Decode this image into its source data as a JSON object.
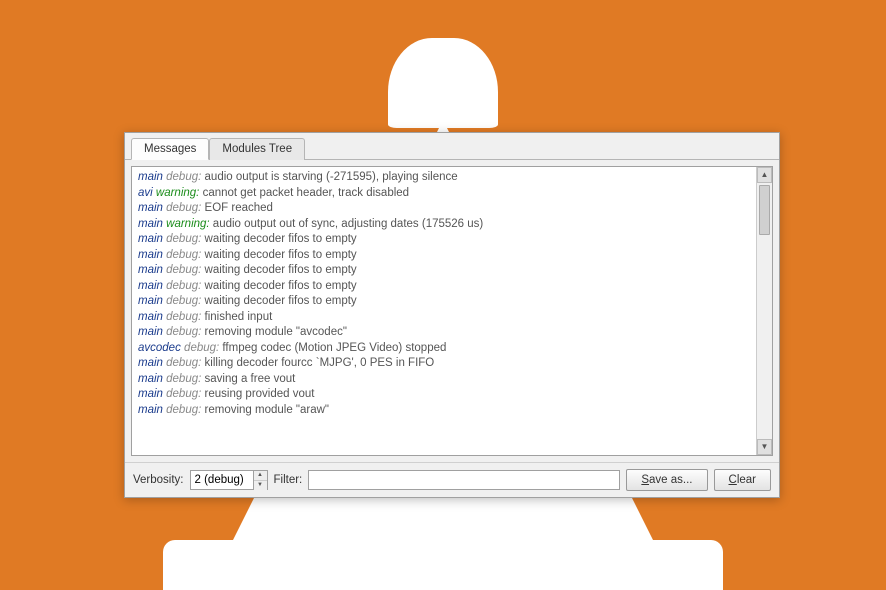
{
  "tabs": {
    "messages": "Messages",
    "modules": "Modules Tree"
  },
  "log_lines": [
    {
      "module": "main",
      "level": "debug",
      "text": " audio output is starving (-271595), playing silence"
    },
    {
      "module": "avi",
      "level": "warning",
      "text": " cannot get packet header, track disabled"
    },
    {
      "module": "main",
      "level": "debug",
      "text": " EOF reached"
    },
    {
      "module": "main",
      "level": "warning",
      "text": " audio output out of sync, adjusting dates (175526 us)"
    },
    {
      "module": "main",
      "level": "debug",
      "text": " waiting decoder fifos to empty"
    },
    {
      "module": "main",
      "level": "debug",
      "text": " waiting decoder fifos to empty"
    },
    {
      "module": "main",
      "level": "debug",
      "text": " waiting decoder fifos to empty"
    },
    {
      "module": "main",
      "level": "debug",
      "text": " waiting decoder fifos to empty"
    },
    {
      "module": "main",
      "level": "debug",
      "text": " waiting decoder fifos to empty"
    },
    {
      "module": "main",
      "level": "debug",
      "text": " finished input"
    },
    {
      "module": "main",
      "level": "debug",
      "text": " removing module \"avcodec\""
    },
    {
      "module": "avcodec",
      "level": "debug",
      "text": " ffmpeg codec (Motion JPEG Video) stopped"
    },
    {
      "module": "main",
      "level": "debug",
      "text": " killing decoder fourcc `MJPG', 0 PES in FIFO"
    },
    {
      "module": "main",
      "level": "debug",
      "text": " saving a free vout"
    },
    {
      "module": "main",
      "level": "debug",
      "text": " reusing provided vout"
    },
    {
      "module": "main",
      "level": "debug",
      "text": " removing module \"araw\""
    }
  ],
  "bottom": {
    "verbosity_label": "Verbosity:",
    "verbosity_value": "2 (debug)",
    "filter_label": "Filter:",
    "filter_value": "",
    "save_prefix": "S",
    "save_rest": "ave as...",
    "clear_prefix": "C",
    "clear_rest": "lear"
  }
}
